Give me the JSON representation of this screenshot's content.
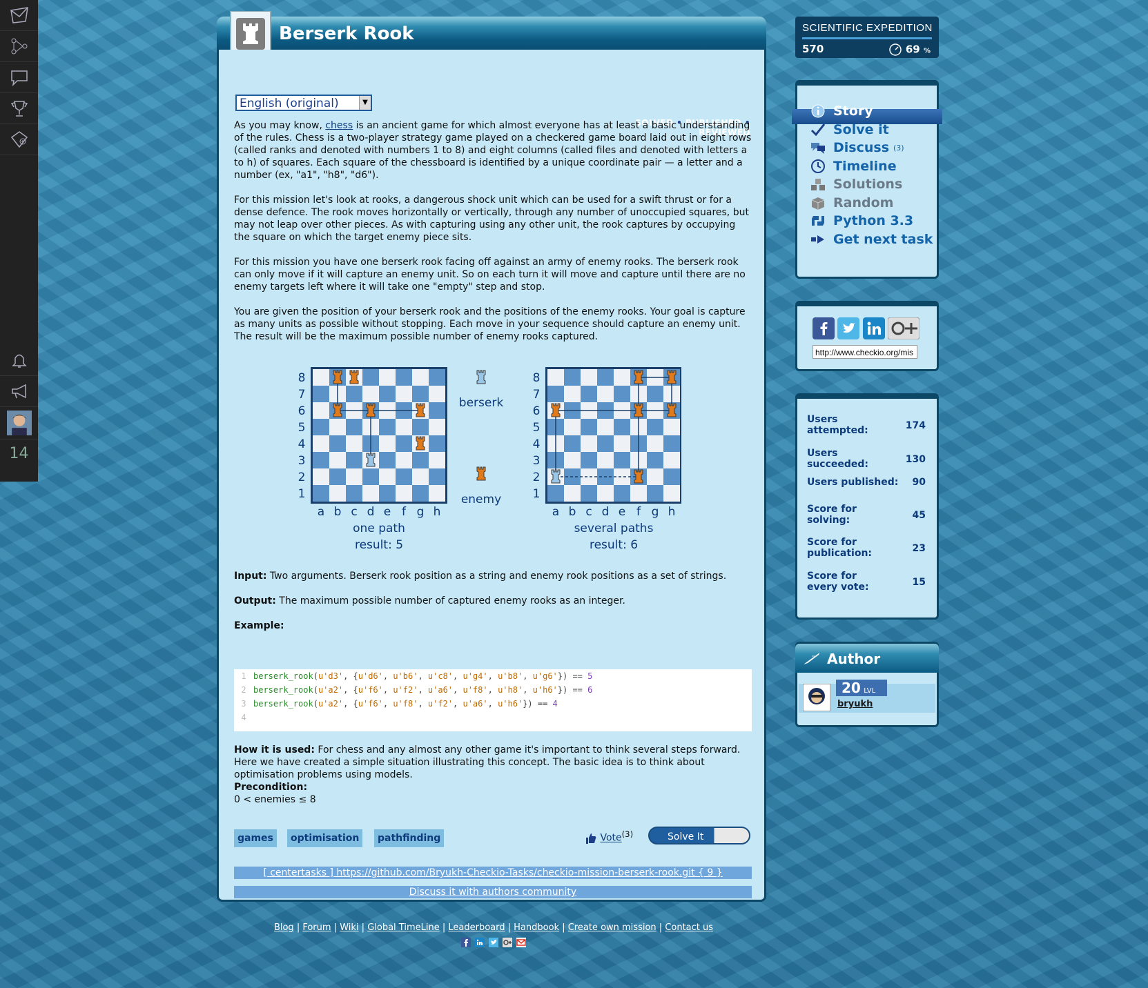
{
  "sidebar": {
    "counter": "14"
  },
  "mission": {
    "title": "Berserk Rook",
    "language": "English (original)",
    "status": [
      "SOLVED",
      "PUBLISHED",
      "REVIEWED"
    ],
    "status_sep": "•",
    "intro_prefix": "As you may know, ",
    "intro_link": "chess",
    "intro_rest": " is an ancient game for which almost everyone has at least a basic understanding of the rules. Chess is a two-player strategy game played on a checkered game board laid out in eight rows (called ranks and denoted with numbers 1 to 8) and eight columns (called files and denoted with letters a to h) of squares. Each square of the chessboard is identified by a unique coordinate pair — a letter and a number (ex, \"a1\", \"h8\", \"d6\").",
    "para2": "For this mission let's look at rooks, a dangerous shock unit which can be used for a swift thrust or for a dense defence. The rook moves horizontally or vertically, through any number of unoccupied squares, but may not leap over other pieces. As with capturing using any other unit, the rook captures by occupying the square on which the target enemy piece sits.",
    "para3": "For this mission you have one berserk rook facing off against an army of enemy rooks. The berserk rook can only move if it will capture an enemy unit. So on each turn it will move and capture until there are no enemy targets left where it will take one \"empty\" step and stop.",
    "para4": "You are given the position of your berserk rook and the positions of the enemy rooks. Your goal is capture as many units as possible without stopping. Each move in your sequence should capture an enemy unit. The result will be the maximum possible number of enemy rooks captured.",
    "figure": {
      "ranks": [
        "8",
        "7",
        "6",
        "5",
        "4",
        "3",
        "2",
        "1"
      ],
      "files": [
        "a",
        "b",
        "c",
        "d",
        "e",
        "f",
        "g",
        "h"
      ],
      "legend_berserk": "berserk",
      "legend_enemy": "enemy",
      "board1_caption": "one path",
      "board1_result": "result: 5",
      "board2_caption": "several paths",
      "board2_result": "result: 6"
    },
    "input_label": "Input:",
    "input_text": " Two arguments. Berserk rook position as a string and enemy rook positions as a set of strings.",
    "output_label": "Output:",
    "output_text": " The maximum possible number of captured enemy rooks as an integer.",
    "example_label": "Example:",
    "code": [
      {
        "n": "1",
        "fn": "berserk_rook",
        "args": [
          "u'd3'",
          "u'd6'",
          "u'b6'",
          "u'c8'",
          "u'g4'",
          "u'b8'",
          "u'g6'"
        ],
        "result": "5"
      },
      {
        "n": "2",
        "fn": "berserk_rook",
        "args": [
          "u'a2'",
          "u'f6'",
          "u'f2'",
          "u'a6'",
          "u'f8'",
          "u'h8'",
          "u'h6'"
        ],
        "result": "6"
      },
      {
        "n": "3",
        "fn": "berserk_rook",
        "args": [
          "u'a2'",
          "u'f6'",
          "u'f8'",
          "u'f2'",
          "u'a6'",
          "u'h6'"
        ],
        "result": "4"
      },
      {
        "n": "4"
      }
    ],
    "how_label": "How it is used:",
    "how_text": " For chess and any almost any other game it's important to think several steps forward. Here we have created a simple situation illustrating this concept. The basic idea is to think about optimisation problems using models.",
    "precondition_label": "Precondition:",
    "precondition_text": "0 < enemies ≤ 8",
    "tags": [
      "games",
      "optimisation",
      "pathfinding"
    ],
    "vote_label": "Vote",
    "vote_count": "(3)",
    "solve_button": "Solve It",
    "repo_link": "[ centertasks ] https://github.com/Bryukh-Checkio-Tasks/checkio-mission-berserk-rook.git { 9 }",
    "discuss_link": "Discuss it with authors community"
  },
  "expedition": {
    "title": "SCIENTIFIC EXPEDITION",
    "points": "570",
    "percent": "69",
    "percent_sign": "%"
  },
  "menu": [
    {
      "label": "Story",
      "icon": "info-icon",
      "active": true
    },
    {
      "label": "Solve it",
      "icon": "checkmark-icon"
    },
    {
      "label": "Discuss",
      "icon": "comments-icon",
      "count": "(3)"
    },
    {
      "label": "Timeline",
      "icon": "clock-icon"
    },
    {
      "label": "Solutions",
      "icon": "blocks-icon",
      "muted": true
    },
    {
      "label": "Random",
      "icon": "box-icon",
      "muted": true
    },
    {
      "label": "Python 3.3",
      "icon": "python-icon"
    },
    {
      "label": "Get next task",
      "icon": "arrow-right-icon"
    }
  ],
  "share": {
    "url": "http://www.checkio.org/mis"
  },
  "stats": [
    {
      "label": "Users attempted:",
      "value": "174"
    },
    {
      "label": "Users succeeded:",
      "value": "130"
    },
    {
      "label": "Users published:",
      "value": "90"
    },
    {
      "label": "Score for solving:",
      "value": "45"
    },
    {
      "label": "Score for publication:",
      "value": "23"
    },
    {
      "label": "Score for every vote:",
      "value": "15"
    }
  ],
  "author": {
    "heading": "Author",
    "level": "20",
    "level_suffix": "LVL",
    "name": "bryukh"
  },
  "footer": {
    "links": [
      "Blog",
      "Forum",
      "Wiki",
      "Global TimeLine",
      "Leaderboard",
      "Handbook",
      "Create own mission",
      "Contact us"
    ],
    "sep": "|"
  },
  "colors": {
    "accent": "#1463a8",
    "panel": "#c6e8f6",
    "dark": "#0c4766",
    "enemy": "#e07a1a",
    "berserk": "#9ac7e8"
  }
}
